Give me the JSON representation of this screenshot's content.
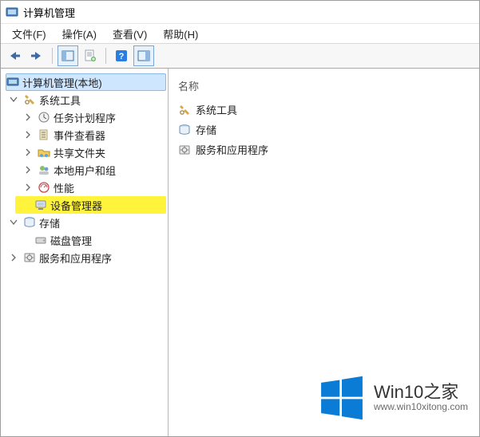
{
  "titlebar": {
    "title": "计算机管理"
  },
  "menubar": {
    "file": "文件(F)",
    "action": "操作(A)",
    "view": "查看(V)",
    "help": "帮助(H)"
  },
  "tree": {
    "root": "计算机管理(本地)",
    "system_tools": "系统工具",
    "task_scheduler": "任务计划程序",
    "event_viewer": "事件查看器",
    "shared_folders": "共享文件夹",
    "local_users_groups": "本地用户和组",
    "performance": "性能",
    "device_manager": "设备管理器",
    "storage": "存储",
    "disk_management": "磁盘管理",
    "services_apps": "服务和应用程序"
  },
  "list": {
    "header_name": "名称",
    "items": {
      "system_tools": "系统工具",
      "storage": "存储",
      "services_apps": "服务和应用程序"
    }
  },
  "watermark": {
    "line1": "Win10之家",
    "line2": "www.win10xitong.com"
  }
}
